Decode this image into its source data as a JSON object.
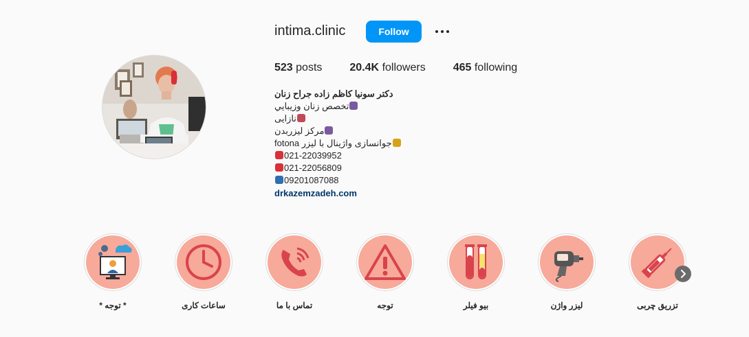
{
  "profile": {
    "username": "intima.clinic",
    "follow_label": "Follow",
    "posts_count": "523",
    "posts_label": "posts",
    "followers_count": "20.4K",
    "followers_label": "followers",
    "following_count": "465",
    "following_label": "following"
  },
  "bio": {
    "name": "دکتر سونیا کاظم زاده جراح زنان",
    "lines": [
      {
        "text": "تخصص زنان وزيبايي",
        "emoji": "woman-health-worker-icon",
        "color": "#7a5a9e"
      },
      {
        "text": "نازایی",
        "emoji": "pregnant-icon",
        "color": "#c04a5a"
      },
      {
        "text": "مرکز لیزربدن",
        "emoji": "woman-health-worker-icon",
        "color": "#7a5a9e"
      },
      {
        "text": "جوانسازی واژینال با لیزر fotona",
        "emoji": "fleur-de-lis-icon",
        "color": "#d6a21a"
      },
      {
        "text": "021-22039952",
        "emoji": "telephone-icon",
        "color": "#d9303a"
      },
      {
        "text": "021-22056809",
        "emoji": "telephone-icon",
        "color": "#d9303a"
      },
      {
        "text": "09201087088",
        "emoji": "mobile-phone-icon",
        "color": "#2f6fb0"
      }
    ],
    "link": "drkazemzadeh.com"
  },
  "highlights": [
    {
      "label": "تزریق چربی",
      "icon": "syringe-icon"
    },
    {
      "label": "لیزر واژن",
      "icon": "laser-device-icon"
    },
    {
      "label": "بیو فیلر",
      "icon": "test-tubes-icon"
    },
    {
      "label": "توجه",
      "icon": "warning-icon"
    },
    {
      "label": "تماس با ما",
      "icon": "phone-icon"
    },
    {
      "label": "ساعات کاری",
      "icon": "clock-icon"
    },
    {
      "label": "* توجه *",
      "icon": "support-agent-icon"
    }
  ],
  "colors": {
    "follow_button": "#0095f6",
    "highlight_bg": "#f7a99a",
    "highlight_icon": "#d9434b",
    "link": "#00376b"
  }
}
